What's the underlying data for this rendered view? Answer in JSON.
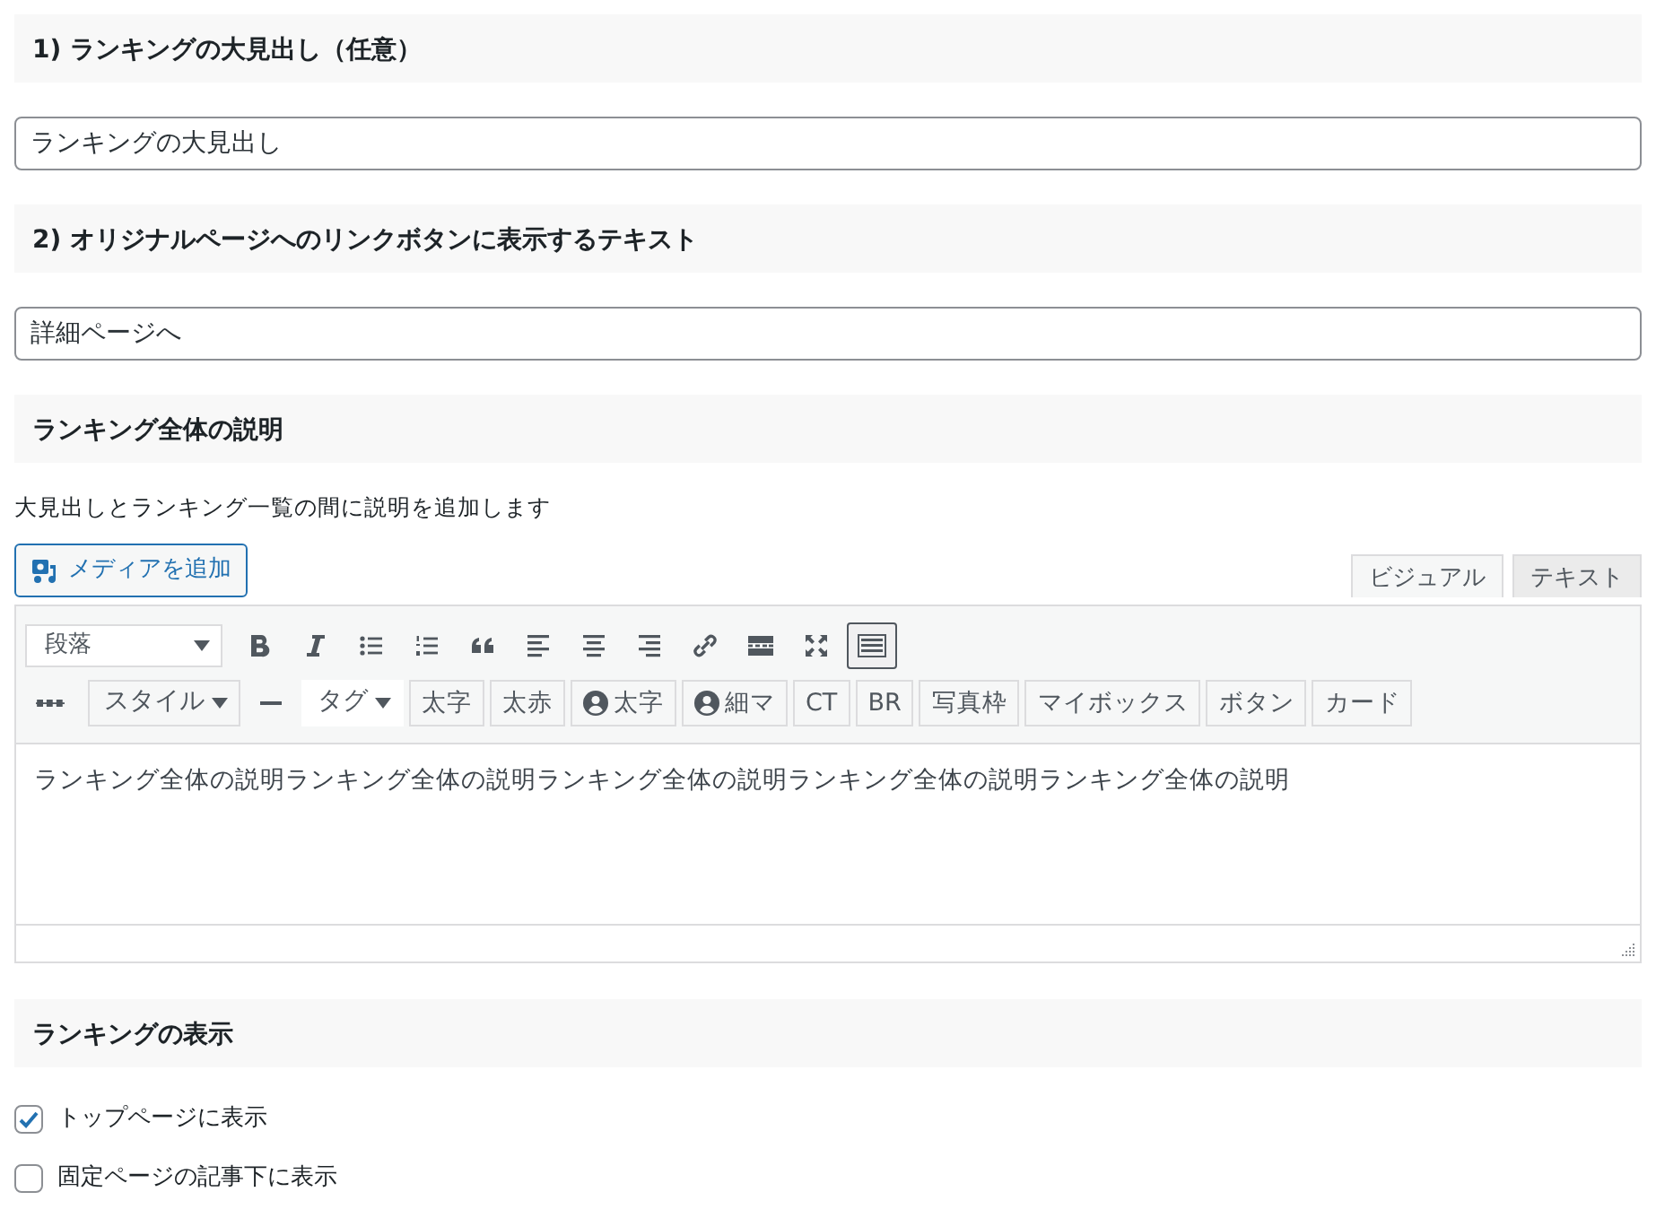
{
  "sections": [
    {
      "heading": "1) ランキングの大見出し（任意）",
      "field": {
        "value": "ランキングの大見出し"
      }
    },
    {
      "heading": "2) オリジナルページへのリンクボタンに表示するテキスト",
      "field": {
        "value": "詳細ページへ"
      }
    },
    {
      "heading": "ランキング全体の説明",
      "description": "大見出しとランキング一覧の間に説明を追加します",
      "editor": {
        "media_button": "メディアを追加",
        "tabs": [
          {
            "label": "ビジュアル",
            "selected": true
          },
          {
            "label": "テキスト",
            "selected": false
          }
        ],
        "toolbar_rows": [
          [
            {
              "kind": "select",
              "label": "段落"
            },
            {
              "kind": "icon",
              "pressed": false
            },
            {
              "kind": "icon",
              "pressed": false
            },
            {
              "kind": "icon",
              "pressed": false
            },
            {
              "kind": "icon",
              "pressed": false
            },
            {
              "kind": "icon",
              "pressed": false
            },
            {
              "kind": "icon",
              "pressed": false
            },
            {
              "kind": "icon",
              "pressed": false
            },
            {
              "kind": "icon",
              "pressed": false
            },
            {
              "kind": "icon",
              "pressed": false
            },
            {
              "kind": "icon",
              "pressed": false
            },
            {
              "kind": "icon",
              "pressed": false
            },
            {
              "kind": "icon",
              "pressed": true
            }
          ],
          [
            {
              "kind": "icon",
              "pressed": false
            },
            {
              "kind": "dropdown",
              "label": "スタイル"
            },
            {
              "kind": "icon",
              "pressed": false
            },
            {
              "kind": "plain-dropdown",
              "label": "タグ"
            },
            {
              "kind": "text",
              "label": "太字"
            },
            {
              "kind": "text",
              "label": "太赤"
            },
            {
              "kind": "icon-text",
              "label": "太字"
            },
            {
              "kind": "icon-text",
              "label": "細マ"
            },
            {
              "kind": "text",
              "label": "CT"
            },
            {
              "kind": "text",
              "label": "BR"
            },
            {
              "kind": "text",
              "label": "写真枠"
            },
            {
              "kind": "text",
              "label": "マイボックス"
            },
            {
              "kind": "text",
              "label": "ボタン"
            },
            {
              "kind": "text",
              "label": "カード"
            }
          ]
        ],
        "content": "ランキング全体の説明ランキング全体の説明ランキング全体の説明ランキング全体の説明ランキング全体の説明"
      }
    },
    {
      "heading": "ランキングの表示",
      "checkboxes": [
        {
          "label": "トップページに表示",
          "checked": true
        },
        {
          "label": "固定ページの記事下に表示",
          "checked": false
        }
      ]
    }
  ]
}
